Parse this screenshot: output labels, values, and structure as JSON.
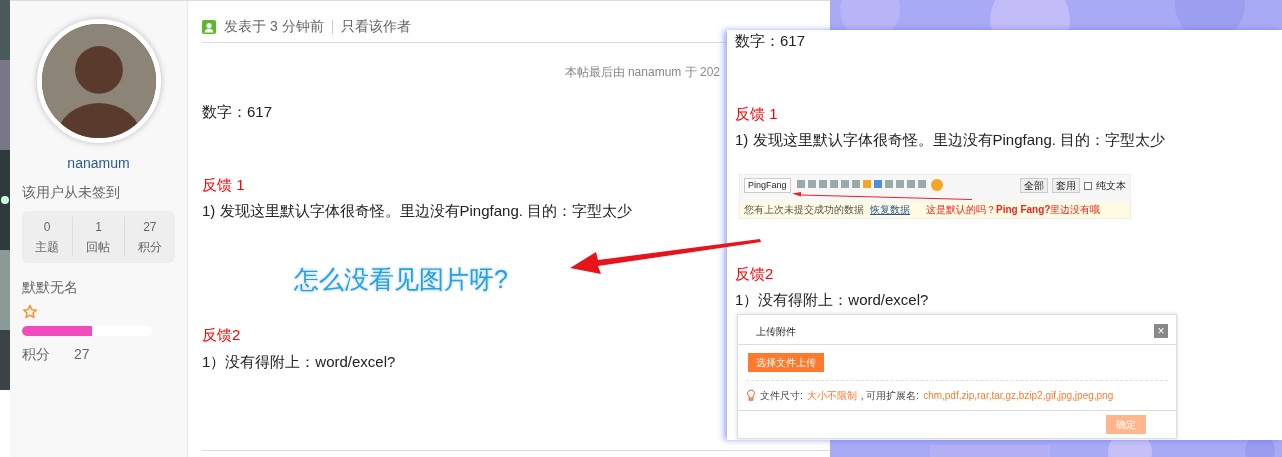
{
  "sidebar": {
    "username": "nanamum",
    "checkin": "该用户从未签到",
    "stats": [
      {
        "value": "0",
        "label": "主题"
      },
      {
        "value": "1",
        "label": "回帖"
      },
      {
        "value": "27",
        "label": "积分"
      }
    ],
    "rank": "默默无名",
    "progress": {
      "level": 0.54
    },
    "points_label": "积分",
    "points_value": "27"
  },
  "post": {
    "posted": "发表于 3 分钟前",
    "author_only": "只看该作者",
    "edit_note": "本帖最后由 nanamum 于 202",
    "blocks": [
      {
        "kind": "text",
        "text": "数字：617"
      },
      {
        "kind": "heading",
        "text": "反馈 1"
      },
      {
        "kind": "text",
        "text": "1) 发现这里默认字体很奇怪。里边没有Pingfang. 目的：字型太少"
      },
      {
        "kind": "callout",
        "text": "怎么没看见图片呀?"
      },
      {
        "kind": "heading",
        "text": "反馈2"
      },
      {
        "kind": "text",
        "text": "1）没有得附上：word/excel?"
      }
    ]
  },
  "inset": {
    "blocks": [
      {
        "kind": "text",
        "text": "数字：617"
      },
      {
        "kind": "heading",
        "text": "反馈 1"
      },
      {
        "kind": "text",
        "text": "1) 发现这里默认字体很奇怪。里边没有Pingfang. 目的：字型太少"
      },
      {
        "kind": "editor"
      },
      {
        "kind": "heading",
        "text": "反馈2"
      },
      {
        "kind": "text",
        "text": "1）没有得附上：word/excel?"
      },
      {
        "kind": "dialog"
      }
    ],
    "editor": {
      "font": "PingFang",
      "buttons": [
        "全部",
        "套用"
      ],
      "plain_text": {
        "label": "纯文本",
        "checked": false
      },
      "notice": "您有上次未提交成功的数据",
      "restore": "恢复数据",
      "annotation": "这是默认的吗？**Ping Fang?**里边没有哦"
    },
    "dialog": {
      "title": "上传附件",
      "close": "×",
      "upload": "选择文件上传",
      "size_label": "文件尺寸:",
      "size_value": "大小不限制",
      "ext_label": ", 可用扩展名:",
      "ext_value": "chm,pdf,zip,rar,tar,gz,bzip2,gif,jpg,jpeg,png",
      "confirm": "确定"
    }
  }
}
